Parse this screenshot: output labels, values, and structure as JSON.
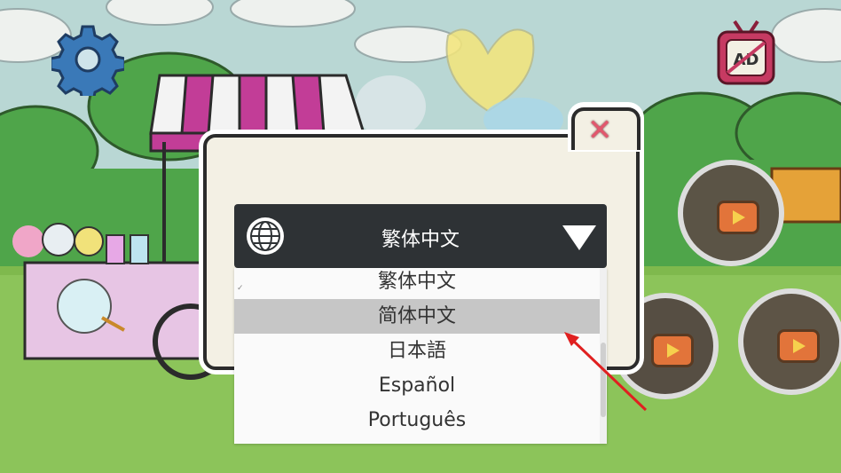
{
  "dialog": {
    "close_symbol": "✕",
    "selected_language": "繁体中文",
    "options": [
      "繁体中文",
      "简体中文",
      "日本語",
      "Español",
      "Português"
    ],
    "highlighted_option": "简体中文"
  },
  "icons": [
    "gear-icon",
    "no-ads-tv-icon",
    "play-icon",
    "globe-icon",
    "caret-down-icon",
    "close-icon"
  ],
  "colors": {
    "accent_close": "#e2576d",
    "select_bg": "#2e3235",
    "highlight": "#c6c6c6",
    "annotation_arrow": "#e02020"
  }
}
